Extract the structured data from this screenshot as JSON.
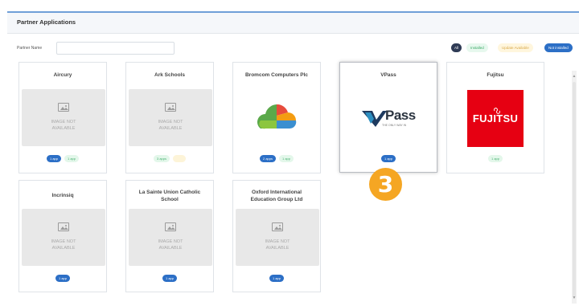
{
  "panel": {
    "title": "Partner Applications"
  },
  "filter": {
    "label": "Partner Name",
    "value": "",
    "placeholder": ""
  },
  "status_filters": [
    {
      "label": "All"
    },
    {
      "label": "Installed"
    },
    {
      "label": "Update Available"
    },
    {
      "label": "Not installed"
    }
  ],
  "placeholder_text": {
    "line1": "IMAGE NOT",
    "line2": "AVAILABLE"
  },
  "cards": [
    {
      "title": "Aircury",
      "badges": [
        {
          "label": "1 app",
          "style": "blue"
        },
        {
          "label": "1 app",
          "style": "green"
        }
      ]
    },
    {
      "title": "Ark Schools",
      "badges": [
        {
          "label": "3 apps",
          "style": "green"
        }
      ]
    },
    {
      "title": "Bromcom Computers Plc",
      "badges": [
        {
          "label": "2 apps",
          "style": "blue"
        },
        {
          "label": "1 app",
          "style": "green"
        }
      ]
    },
    {
      "title": "VPass",
      "logo_main": "Pass",
      "logo_tag": "THE ONLY WAY IN",
      "badges": [
        {
          "label": "1 app",
          "style": "blue"
        }
      ]
    },
    {
      "title": "Fujitsu",
      "logo_text": "FUJITSU",
      "badges": [
        {
          "label": "1 app",
          "style": "green"
        }
      ]
    },
    {
      "title": "Incrinsiq",
      "badges": [
        {
          "label": "1 app",
          "style": "blue"
        }
      ]
    },
    {
      "title": "La Sainte Union Catholic School",
      "badges": [
        {
          "label": "1 app",
          "style": "blue"
        }
      ]
    },
    {
      "title": "Oxford International Education Group Ltd",
      "badges": [
        {
          "label": "1 app",
          "style": "blue"
        }
      ]
    }
  ],
  "step_marker": "3",
  "colors": {
    "accent": "#2c6fc6",
    "installed": "#47b070",
    "update": "#d9a94a",
    "marker": "#f5a623",
    "fujitsu_red": "#e60012"
  }
}
